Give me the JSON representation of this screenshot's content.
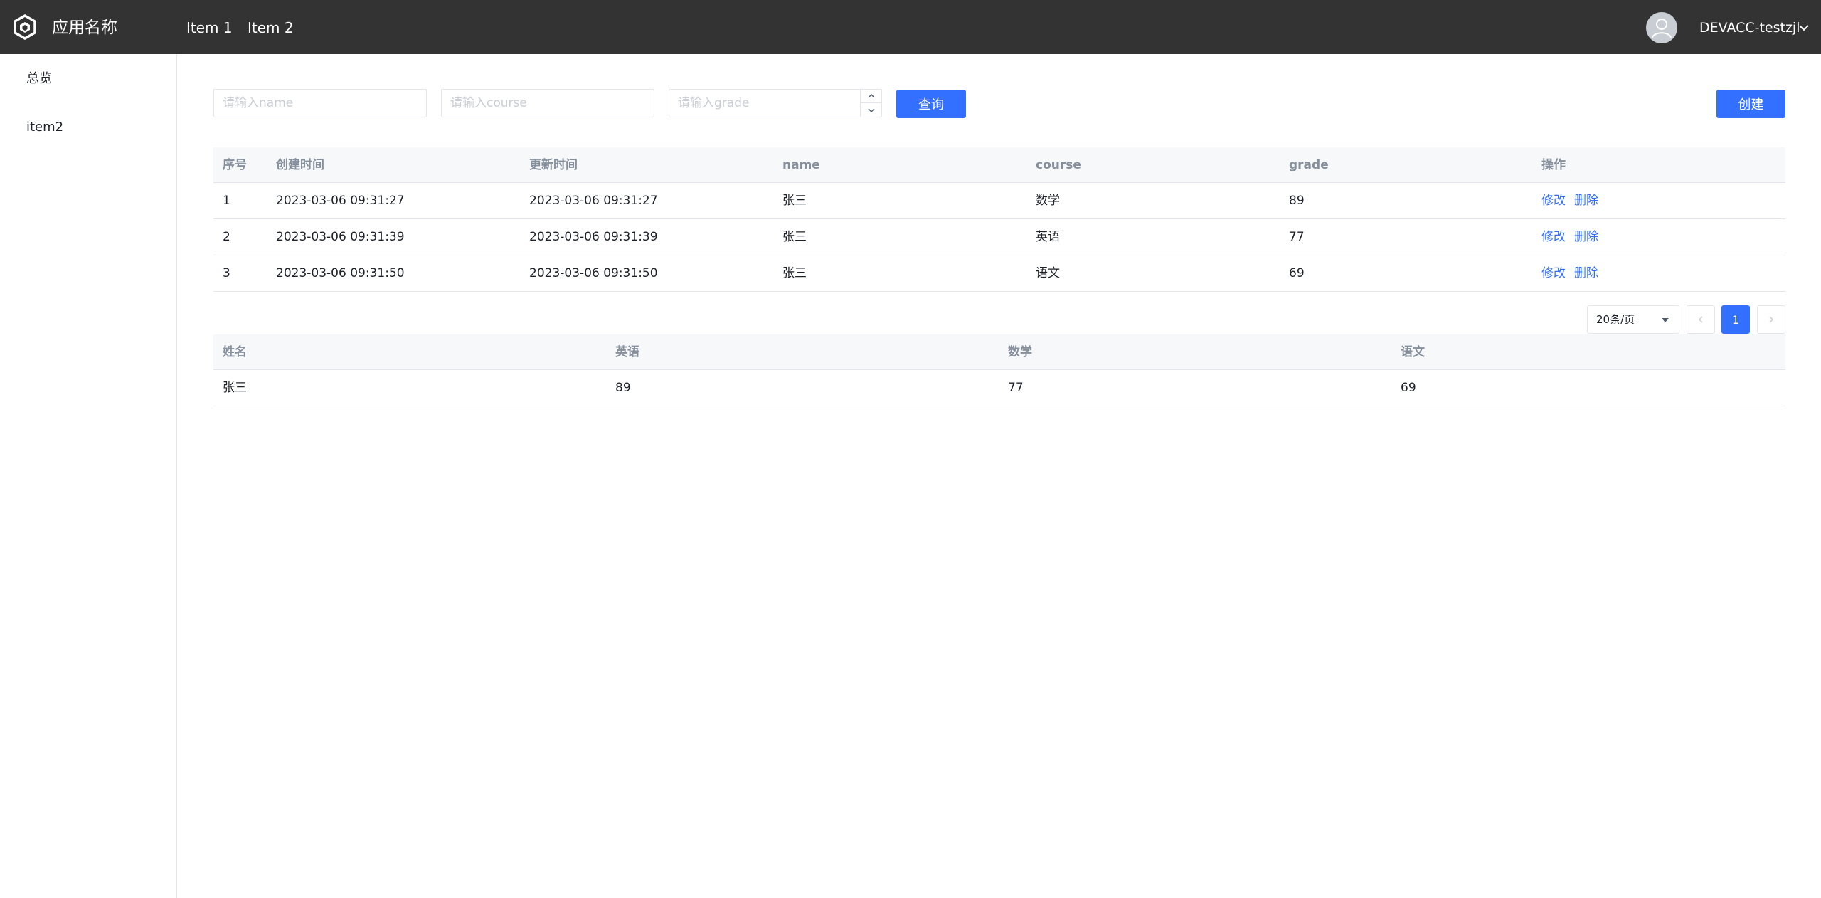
{
  "header": {
    "app_name": "应用名称",
    "nav": [
      "Item 1",
      "Item 2"
    ],
    "user": "DEVACC-testzjl"
  },
  "sidebar": {
    "items": [
      "总览",
      "item2"
    ]
  },
  "filters": {
    "name_placeholder": "请输入name",
    "course_placeholder": "请输入course",
    "grade_placeholder": "请输入grade",
    "query_label": "查询",
    "create_label": "创建"
  },
  "records_table": {
    "columns": [
      "序号",
      "创建时间",
      "更新时间",
      "name",
      "course",
      "grade",
      "操作"
    ],
    "rows": [
      {
        "index": "1",
        "created": "2023-03-06 09:31:27",
        "updated": "2023-03-06 09:31:27",
        "name": "张三",
        "course": "数学",
        "grade": "89"
      },
      {
        "index": "2",
        "created": "2023-03-06 09:31:39",
        "updated": "2023-03-06 09:31:39",
        "name": "张三",
        "course": "英语",
        "grade": "77"
      },
      {
        "index": "3",
        "created": "2023-03-06 09:31:50",
        "updated": "2023-03-06 09:31:50",
        "name": "张三",
        "course": "语文",
        "grade": "69"
      }
    ],
    "edit_label": "修改",
    "delete_label": "删除"
  },
  "pagination": {
    "page_size": "20条/页",
    "current_page": "1"
  },
  "summary_table": {
    "columns": [
      "姓名",
      "英语",
      "数学",
      "语文"
    ],
    "rows": [
      {
        "name": "张三",
        "english": "89",
        "math": "77",
        "chinese": "69"
      }
    ]
  },
  "colors": {
    "topbar": "#333333",
    "primary": "#3370ff",
    "table_header_bg": "#f7f8fa",
    "border": "#e5e6eb"
  }
}
